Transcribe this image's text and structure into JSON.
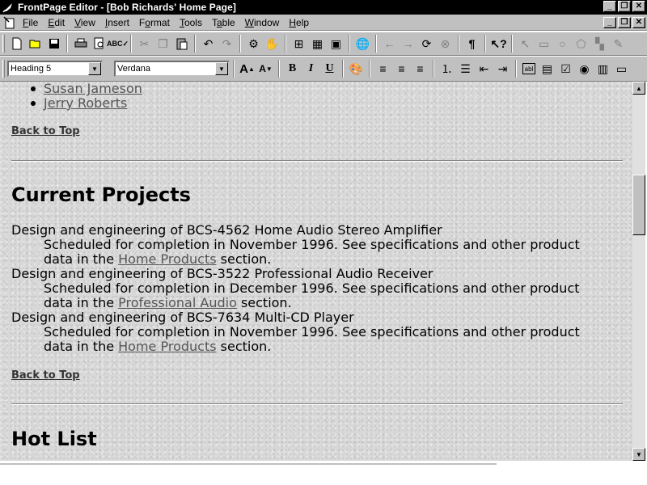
{
  "window": {
    "title": "FrontPage Editor - [Bob Richards' Home Page]"
  },
  "menu": {
    "items": [
      {
        "label": "File",
        "key": "F",
        "rest": "ile"
      },
      {
        "label": "Edit",
        "key": "E",
        "rest": "dit"
      },
      {
        "label": "View",
        "key": "V",
        "rest": "iew"
      },
      {
        "label": "Insert",
        "key": "I",
        "rest": "nsert"
      },
      {
        "label": "Format",
        "key": "F",
        "rest": "ormat",
        "pre": ""
      },
      {
        "label": "Tools",
        "key": "T",
        "rest": "ools"
      },
      {
        "label": "Table",
        "key": "a",
        "pre": "T",
        "rest": "ble"
      },
      {
        "label": "Window",
        "key": "W",
        "rest": "indow"
      },
      {
        "label": "Help",
        "key": "H",
        "rest": "elp"
      }
    ]
  },
  "format_toolbar": {
    "style_value": "Heading 5",
    "font_value": "Verdana"
  },
  "content": {
    "list_items": [
      "Susan Jameson",
      "Jerry Roberts"
    ],
    "back_to_top": "Back to Top",
    "section1_heading": "Current Projects",
    "projects": [
      {
        "title": "Design and engineering of BCS-4562 Home Audio Stereo Amplifier",
        "line1": "Scheduled for completion in November 1996. See specifications and other product",
        "pre": "data in the ",
        "link": "Home Products",
        "post": " section."
      },
      {
        "title": "Design and engineering of BCS-3522 Professional Audio Receiver",
        "line1": "Scheduled for completion in December 1996. See specifications and other product",
        "pre": "data in the ",
        "link": "Professional Audio",
        "post": " section."
      },
      {
        "title": "Design and engineering of BCS-7634 Multi-CD Player",
        "line1": "Scheduled for completion in November 1996. See specifications and other product",
        "pre": "data in the ",
        "link": "Home Products",
        "post": " section."
      }
    ],
    "section2_heading": "Hot List"
  },
  "colors": {
    "titlebar": "#000000",
    "chrome": "#c0c0c0",
    "link": "#555555"
  }
}
